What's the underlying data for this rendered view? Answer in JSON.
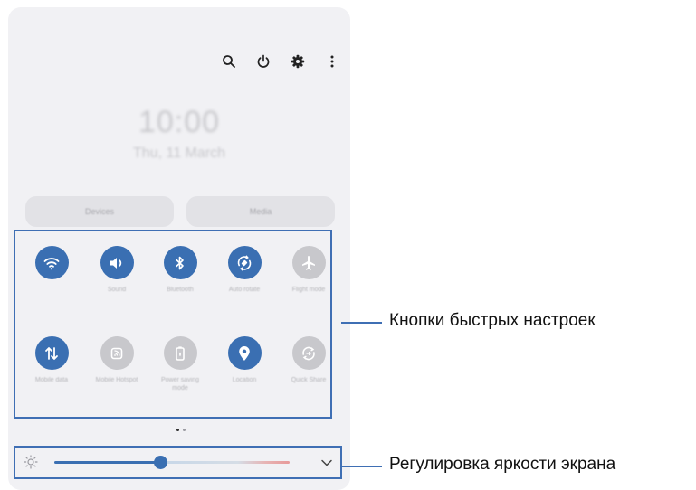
{
  "header": {
    "clock": "10:00",
    "date": "Thu, 11 March",
    "icons": [
      "search-icon",
      "power-icon",
      "gear-icon",
      "more-vert-icon"
    ]
  },
  "pills": {
    "devices": "Devices",
    "media": "Media"
  },
  "quick_settings": {
    "row1": [
      {
        "label": "",
        "icon": "wifi-icon",
        "on": true
      },
      {
        "label": "Sound",
        "icon": "volume-icon",
        "on": true
      },
      {
        "label": "Bluetooth",
        "icon": "bluetooth-icon",
        "on": true
      },
      {
        "label": "Auto rotate",
        "icon": "auto-rotate-icon",
        "on": true
      },
      {
        "label": "Flight mode",
        "icon": "airplane-icon",
        "on": false
      }
    ],
    "row2": [
      {
        "label": "Mobile data",
        "icon": "mobile-data-icon",
        "on": true
      },
      {
        "label": "Mobile Hotspot",
        "icon": "hotspot-icon",
        "on": false
      },
      {
        "label": "Power saving mode",
        "icon": "battery-icon",
        "on": false
      },
      {
        "label": "Location",
        "icon": "location-icon",
        "on": true
      },
      {
        "label": "Quick Share",
        "icon": "quick-share-icon",
        "on": false
      }
    ]
  },
  "page_indicator": {
    "count": 2,
    "active": 0
  },
  "brightness": {
    "level": 0.45,
    "icon": "sun-icon",
    "expand_icon": "chevron-down-icon"
  },
  "callouts": {
    "quick_settings": "Кнопки быстрых настроек",
    "brightness": "Регулировка яркости экрана"
  },
  "colors": {
    "accent": "#3a6fb2",
    "frame": "#3f6fb4",
    "panel": "#f1f1f4",
    "tile_off": "#c8c8cc"
  }
}
